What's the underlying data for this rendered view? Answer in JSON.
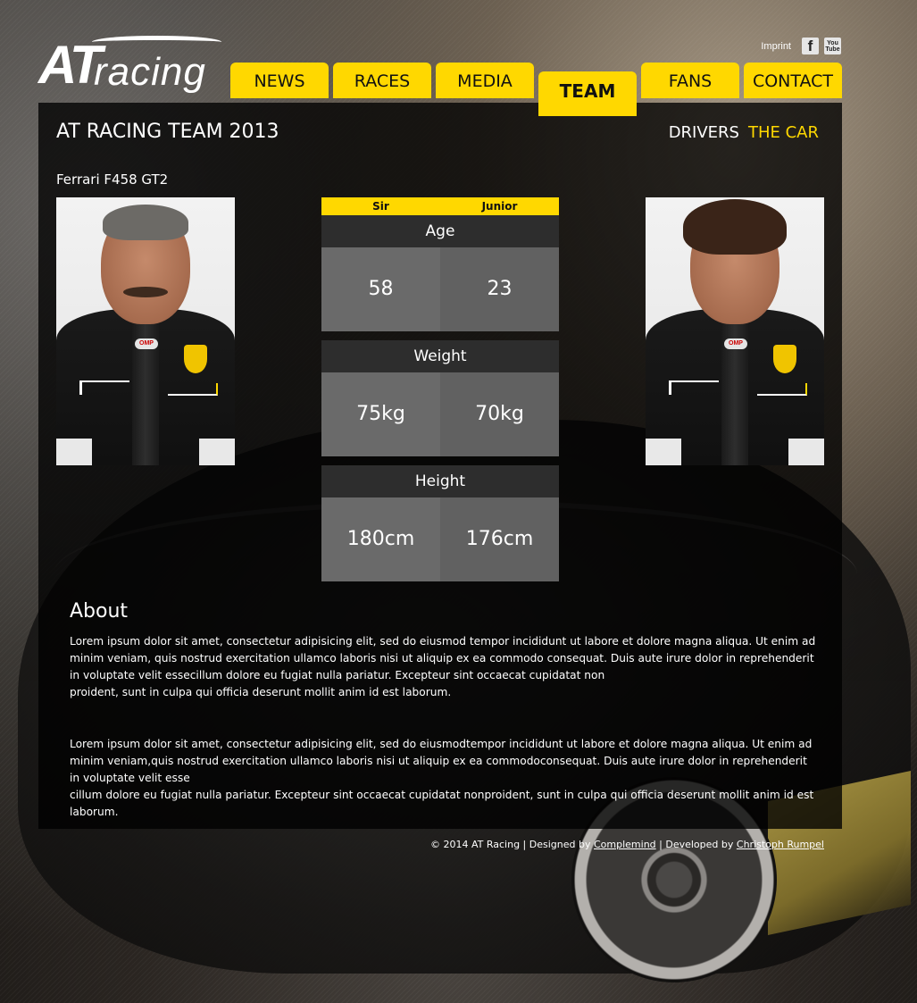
{
  "brand": {
    "logo_main": "AT",
    "logo_sub": "racing"
  },
  "top_links": {
    "imprint": "Imprint",
    "facebook_icon": "facebook-icon",
    "facebook_glyph": "f",
    "youtube_icon": "youtube-icon",
    "youtube_glyph_top": "You",
    "youtube_glyph_bottom": "Tube"
  },
  "nav": {
    "items": [
      {
        "label": "NEWS"
      },
      {
        "label": "RACES"
      },
      {
        "label": "MEDIA"
      },
      {
        "label": "TEAM",
        "active": true
      },
      {
        "label": "FANS"
      },
      {
        "label": "CONTACT"
      }
    ],
    "accent_color": "#ffd800"
  },
  "team": {
    "title": "AT RACING TEAM 2013",
    "subnav": [
      {
        "label": "DRIVERS"
      },
      {
        "label": "THE CAR",
        "current": true
      }
    ],
    "car_model": "Ferrari F458 GT2"
  },
  "drivers": {
    "sir": {
      "photo_alt": "Sir"
    },
    "junior": {
      "photo_alt": "Junior"
    }
  },
  "stats": {
    "columns": [
      "Sir",
      "Junior"
    ],
    "rows": [
      {
        "label": "Age",
        "sir": "58",
        "junior": "23"
      },
      {
        "label": "Weight",
        "sir": "75kg",
        "junior": "70kg"
      },
      {
        "label": "Height",
        "sir": "180cm",
        "junior": "176cm"
      }
    ]
  },
  "about": {
    "title": "About",
    "p1_line1": "Lorem ipsum dolor sit amet, consectetur adipisicing elit, sed do eiusmod tempor incididunt ut labore et dolore magna aliqua. Ut enim ad minim veniam, quis nostrud exercitation ullamco laboris nisi ut aliquip ex ea commodo consequat. Duis aute irure dolor in reprehenderit in voluptate velit essecillum dolore eu fugiat nulla pariatur. Excepteur sint occaecat cupidatat non",
    "p1_line2": "proident, sunt in culpa qui officia deserunt mollit anim id est laborum.",
    "p2_line1": "Lorem ipsum dolor sit amet, consectetur adipisicing elit, sed do eiusmodtempor incididunt ut labore et dolore magna aliqua. Ut enim ad minim veniam,quis nostrud exercitation ullamco laboris nisi ut aliquip ex ea commodoconsequat. Duis aute irure dolor in reprehenderit in voluptate velit esse",
    "p2_line2": "cillum dolore eu fugiat nulla pariatur. Excepteur sint occaecat cupidatat nonproident, sunt in culpa qui officia deserunt mollit anim id est laborum."
  },
  "footer": {
    "copyright": "© 2014 AT Racing | Designed by",
    "designer": "Complemind",
    "separator": "| Developed by",
    "developer": "Christoph Rumpel"
  }
}
